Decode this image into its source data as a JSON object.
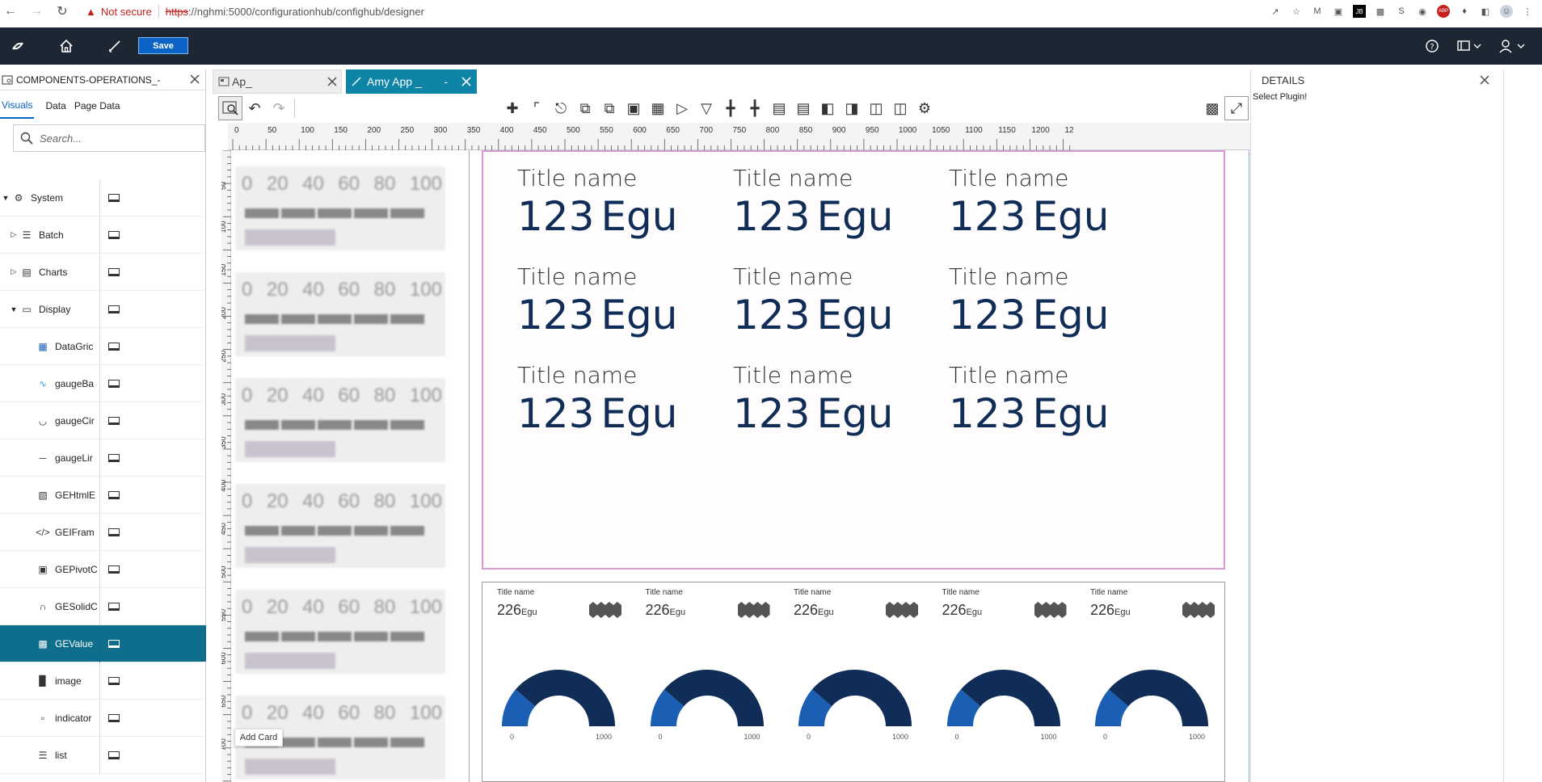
{
  "browser": {
    "warning": "Not secure",
    "url_scheme": "https",
    "url_rest": "://nghmi:5000/configurationhub/confighub/designer"
  },
  "appbar": {
    "save_label": "Save"
  },
  "left_panel": {
    "title": "COMPONENTS-OPERATIONS_-",
    "tabs": [
      "Visuals",
      "Data",
      "Page Data"
    ],
    "search_placeholder": "Search...",
    "tree": [
      {
        "label": "System",
        "expanded": true,
        "level": 0
      },
      {
        "label": "Batch",
        "expanded": false,
        "level": 1
      },
      {
        "label": "Charts",
        "expanded": false,
        "level": 1
      },
      {
        "label": "Display",
        "expanded": true,
        "level": 1
      },
      {
        "label": "DataGric",
        "level": 2
      },
      {
        "label": "gaugeBa",
        "level": 2
      },
      {
        "label": "gaugeCir",
        "level": 2
      },
      {
        "label": "gaugeLir",
        "level": 2
      },
      {
        "label": "GEHtmlE",
        "level": 2
      },
      {
        "label": "GEIFram",
        "level": 2
      },
      {
        "label": "GEPivotC",
        "level": 2
      },
      {
        "label": "GESolidC",
        "level": 2
      },
      {
        "label": "GEValue",
        "level": 2,
        "selected": true
      },
      {
        "label": "image",
        "level": 2
      },
      {
        "label": "indicator",
        "level": 2
      },
      {
        "label": "list",
        "level": 2
      }
    ]
  },
  "doc_tabs": [
    {
      "label": "Ap_",
      "active": false
    },
    {
      "label": "Amy App _",
      "modified": "-",
      "active": true
    }
  ],
  "ruler": {
    "h_ticks": [
      "0",
      "50",
      "100",
      "150",
      "200",
      "250",
      "300",
      "350",
      "400",
      "450",
      "500",
      "550",
      "600",
      "650",
      "700",
      "750",
      "800",
      "850",
      "900",
      "950",
      "1000",
      "1050",
      "1100",
      "1150",
      "1200",
      "12"
    ],
    "v_ticks": [
      "50",
      "100",
      "150",
      "200",
      "250",
      "300",
      "350",
      "400",
      "450",
      "500",
      "550",
      "600",
      "650",
      "700",
      "750"
    ]
  },
  "thumbnail": {
    "nums": [
      "0",
      "20",
      "40",
      "60",
      "80",
      "100"
    ],
    "add_card": "Add Card"
  },
  "value_cards": {
    "title": "Title name",
    "value": "123",
    "unit": "Egu"
  },
  "gauges": {
    "title": "Title name",
    "value": "226",
    "unit": "Egu",
    "min": "0",
    "max": "1000",
    "count": 5
  },
  "details": {
    "title": "DETAILS",
    "message": "Select Plugin!"
  },
  "colors": {
    "appbar": "#1c2733",
    "accent": "#0e84a6",
    "gauge_dark": "#0f2d57",
    "gauge_light": "#1a5fb4"
  }
}
